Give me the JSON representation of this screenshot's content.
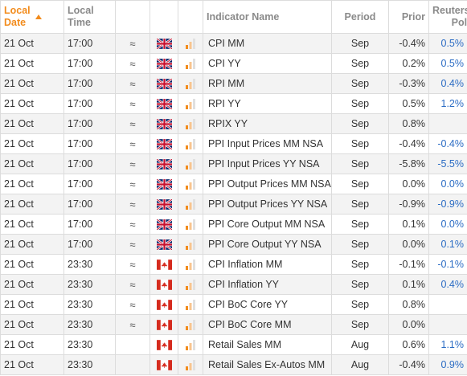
{
  "header": {
    "local_date": "Local\nDate",
    "local_time": "Local\nTime",
    "indicator_name": "Indicator Name",
    "period": "Period",
    "prior": "Prior",
    "reuters_poll": "Reuters\nPoll"
  },
  "colors": {
    "accent": "#f28c1d",
    "poll": "#2b6cc4",
    "stripe": "#f3f3f3"
  },
  "rows": [
    {
      "date": "21 Oct",
      "time": "17:00",
      "approx": "≈",
      "flag": "uk-flag-icon",
      "importance": "importance-bars-icon",
      "name": "CPI MM",
      "period": "Sep",
      "prior": "-0.4%",
      "poll": "0.5%"
    },
    {
      "date": "21 Oct",
      "time": "17:00",
      "approx": "≈",
      "flag": "uk-flag-icon",
      "importance": "importance-bars-icon",
      "name": "CPI YY",
      "period": "Sep",
      "prior": "0.2%",
      "poll": "0.5%"
    },
    {
      "date": "21 Oct",
      "time": "17:00",
      "approx": "≈",
      "flag": "uk-flag-icon",
      "importance": "importance-bars-icon",
      "name": "RPI MM",
      "period": "Sep",
      "prior": "-0.3%",
      "poll": "0.4%"
    },
    {
      "date": "21 Oct",
      "time": "17:00",
      "approx": "≈",
      "flag": "uk-flag-icon",
      "importance": "importance-bars-icon",
      "name": "RPI YY",
      "period": "Sep",
      "prior": "0.5%",
      "poll": "1.2%"
    },
    {
      "date": "21 Oct",
      "time": "17:00",
      "approx": "≈",
      "flag": "uk-flag-icon",
      "importance": "importance-bars-icon",
      "name": "RPIX YY",
      "period": "Sep",
      "prior": "0.8%",
      "poll": ""
    },
    {
      "date": "21 Oct",
      "time": "17:00",
      "approx": "≈",
      "flag": "uk-flag-icon",
      "importance": "importance-bars-icon",
      "name": "PPI Input Prices MM NSA",
      "period": "Sep",
      "prior": "-0.4%",
      "poll": "-0.4%"
    },
    {
      "date": "21 Oct",
      "time": "17:00",
      "approx": "≈",
      "flag": "uk-flag-icon",
      "importance": "importance-bars-icon",
      "name": "PPI Input Prices YY NSA",
      "period": "Sep",
      "prior": "-5.8%",
      "poll": "-5.5%"
    },
    {
      "date": "21 Oct",
      "time": "17:00",
      "approx": "≈",
      "flag": "uk-flag-icon",
      "importance": "importance-bars-icon",
      "name": "PPI Output Prices MM NSA",
      "period": "Sep",
      "prior": "0.0%",
      "poll": "0.0%"
    },
    {
      "date": "21 Oct",
      "time": "17:00",
      "approx": "≈",
      "flag": "uk-flag-icon",
      "importance": "importance-bars-icon",
      "name": "PPI Output Prices YY NSA",
      "period": "Sep",
      "prior": "-0.9%",
      "poll": "-0.9%"
    },
    {
      "date": "21 Oct",
      "time": "17:00",
      "approx": "≈",
      "flag": "uk-flag-icon",
      "importance": "importance-bars-icon",
      "name": "PPI Core Output MM NSA",
      "period": "Sep",
      "prior": "0.1%",
      "poll": "0.0%"
    },
    {
      "date": "21 Oct",
      "time": "17:00",
      "approx": "≈",
      "flag": "uk-flag-icon",
      "importance": "importance-bars-icon",
      "name": "PPI Core Output YY NSA",
      "period": "Sep",
      "prior": "0.0%",
      "poll": "0.1%"
    },
    {
      "date": "21 Oct",
      "time": "23:30",
      "approx": "≈",
      "flag": "canada-flag-icon",
      "importance": "importance-bars-icon",
      "name": "CPI Inflation MM",
      "period": "Sep",
      "prior": "-0.1%",
      "poll": "-0.1%"
    },
    {
      "date": "21 Oct",
      "time": "23:30",
      "approx": "≈",
      "flag": "canada-flag-icon",
      "importance": "importance-bars-icon",
      "name": "CPI Inflation YY",
      "period": "Sep",
      "prior": "0.1%",
      "poll": "0.4%"
    },
    {
      "date": "21 Oct",
      "time": "23:30",
      "approx": "≈",
      "flag": "canada-flag-icon",
      "importance": "importance-bars-icon",
      "name": "CPI BoC Core YY",
      "period": "Sep",
      "prior": "0.8%",
      "poll": ""
    },
    {
      "date": "21 Oct",
      "time": "23:30",
      "approx": "≈",
      "flag": "canada-flag-icon",
      "importance": "importance-bars-icon",
      "name": "CPI BoC Core MM",
      "period": "Sep",
      "prior": "0.0%",
      "poll": ""
    },
    {
      "date": "21 Oct",
      "time": "23:30",
      "approx": "",
      "flag": "canada-flag-icon",
      "importance": "importance-bars-icon",
      "name": "Retail Sales MM",
      "period": "Aug",
      "prior": "0.6%",
      "poll": "1.1%"
    },
    {
      "date": "21 Oct",
      "time": "23:30",
      "approx": "",
      "flag": "canada-flag-icon",
      "importance": "importance-bars-icon",
      "name": "Retail Sales Ex-Autos MM",
      "period": "Aug",
      "prior": "-0.4%",
      "poll": "0.9%"
    }
  ]
}
